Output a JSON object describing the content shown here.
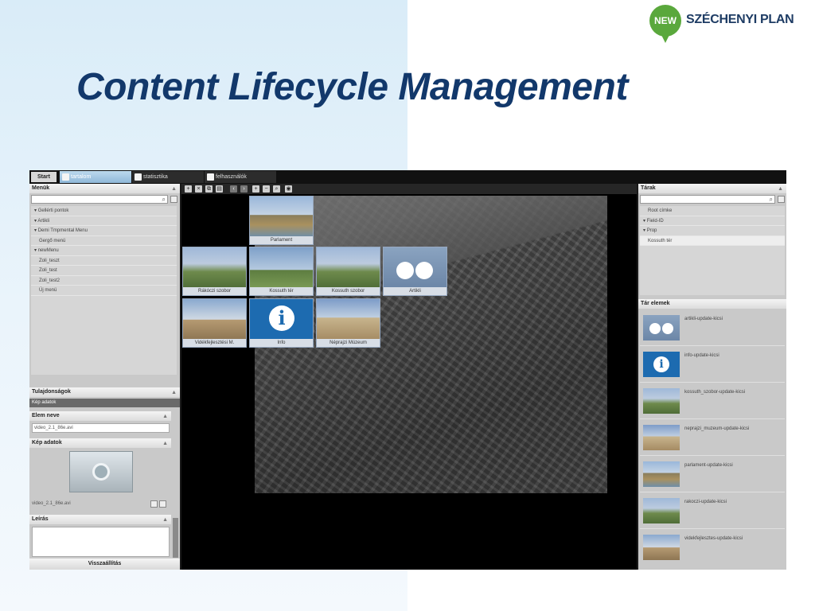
{
  "slide": {
    "title": "Content Lifecycle Management",
    "logo_badge": "NEW",
    "logo_text": "SZÉCHENYI PLAN"
  },
  "topbar": {
    "start": "Start",
    "tabs": [
      {
        "label": "tartalom",
        "active": true
      },
      {
        "label": "statisztika",
        "active": false
      },
      {
        "label": "felhasználók",
        "active": false
      }
    ]
  },
  "left": {
    "menus_title": "Menük",
    "menu_items": [
      "Gellérti pontok",
      "Artikli",
      "Demi Tmpmental Menu",
      "Gergő menü",
      "newMenu",
      "Zoli_teszt",
      "Zoli_test",
      "Zoli_test2",
      "Új menü"
    ],
    "props_title": "Tulajdonságok",
    "props_sub": "Kép adatok",
    "name_title": "Elem neve",
    "name_value": "video_2.1_86e.avi",
    "image_title": "Kép adatok",
    "image_value": "video_2.1_86e.avi",
    "desc_title": "Leírás",
    "reset_label": "Visszaállítás"
  },
  "stage": {
    "tiles": [
      {
        "label": "Parlament"
      },
      {
        "label": "Rákóczi szobor"
      },
      {
        "label": "Kossuth tér"
      },
      {
        "label": "Kossuth szobor"
      },
      {
        "label": "Artikli"
      },
      {
        "label": "Vidékfejlesztési M."
      },
      {
        "label": "Info"
      },
      {
        "label": "Néprajzi Múzeum"
      }
    ]
  },
  "right": {
    "repos_title": "Tárak",
    "repo_items": [
      "Root címke",
      "Field-ID",
      "Prop",
      "Kossuth tér"
    ],
    "elements_title": "Tár elemek",
    "elements": [
      {
        "label": "artikli-update-kicsi"
      },
      {
        "label": "info-update-kicsi"
      },
      {
        "label": "kossuth_szobor-update-kicsi"
      },
      {
        "label": "neprajzi_muzeum-update-kicsi"
      },
      {
        "label": "parlament-update-kicsi"
      },
      {
        "label": "rakoczi-update-kicsi"
      },
      {
        "label": "videkfejlesztes-update-kicsi"
      }
    ]
  },
  "colors": {
    "title": "#12386b",
    "logo_green": "#5aa83c",
    "tile_frame": "#7e96b3"
  }
}
